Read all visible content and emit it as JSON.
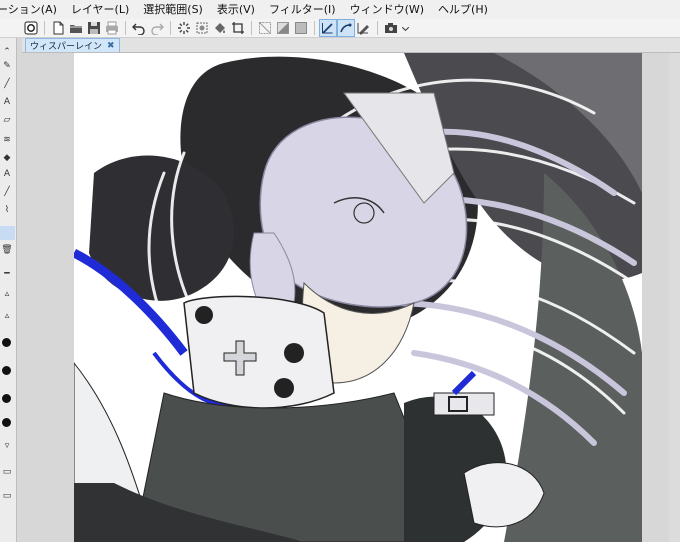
{
  "menubar": {
    "items": [
      "メーション(A)",
      "レイヤー(L)",
      "選択範囲(S)",
      "表示(V)",
      "フィルター(I)",
      "ウィンドウ(W)",
      "ヘルプ(H)"
    ]
  },
  "toolbar": {
    "icons": [
      "app-logo-icon",
      "new-file-icon",
      "open-folder-icon",
      "save-icon",
      "print-icon",
      "undo-icon",
      "redo-icon",
      "loading-spinner-icon",
      "transform-icon",
      "fill-icon",
      "crop-icon",
      "deselect-icon",
      "invert-selection-icon",
      "select-all-icon",
      "pen-tool-icon",
      "lasso-tool-icon",
      "correction-tool-icon",
      "camera-icon",
      "dropdown-arrow-icon"
    ]
  },
  "tabs": [
    {
      "label": "ウィスパーレイン",
      "active": true,
      "close_glyph": "✖"
    }
  ],
  "colors": {
    "accent_blue": "#1f2bd6",
    "hair": "#c9c6dc",
    "dark_bg": "#2b2b2e",
    "tab_active": "#d2e6fa"
  }
}
